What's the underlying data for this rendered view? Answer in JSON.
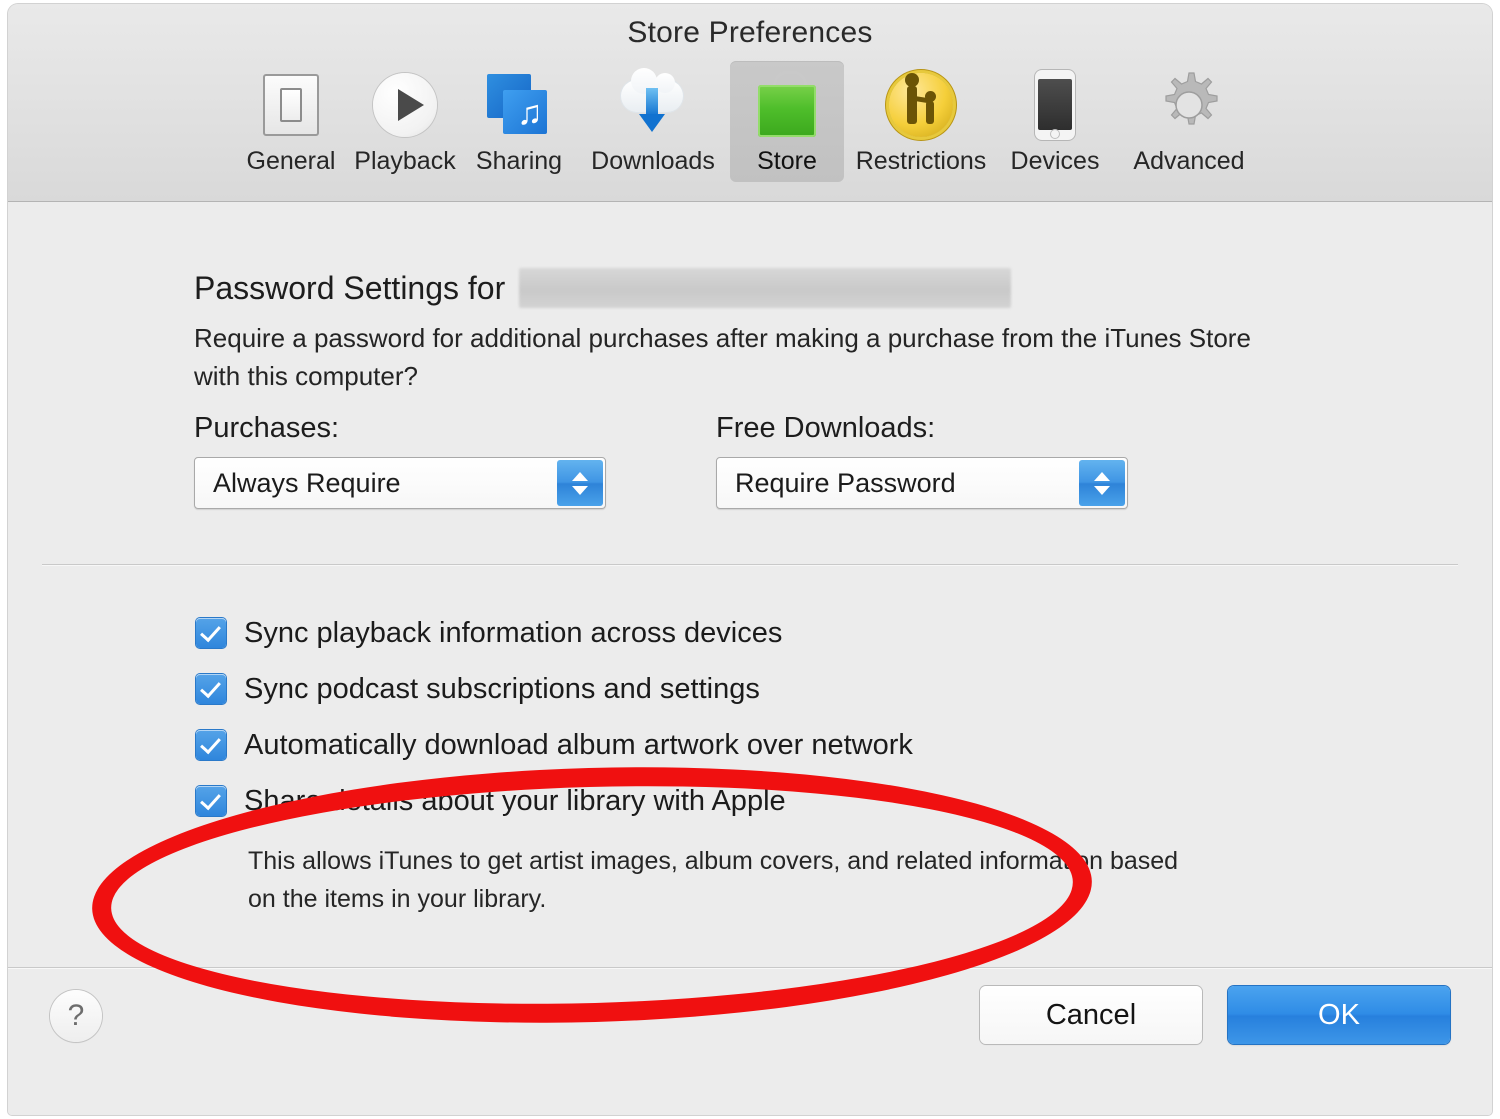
{
  "window": {
    "title": "Store Preferences"
  },
  "toolbar": {
    "tabs": [
      {
        "label": "General",
        "icon": "general-icon",
        "selected": false
      },
      {
        "label": "Playback",
        "icon": "play-icon",
        "selected": false
      },
      {
        "label": "Sharing",
        "icon": "sharing-icon",
        "selected": false
      },
      {
        "label": "Downloads",
        "icon": "cloud-download-icon",
        "selected": false
      },
      {
        "label": "Store",
        "icon": "shopping-bag-icon",
        "selected": true
      },
      {
        "label": "Restrictions",
        "icon": "parental-controls-icon",
        "selected": false
      },
      {
        "label": "Devices",
        "icon": "iphone-icon",
        "selected": false
      },
      {
        "label": "Advanced",
        "icon": "gear-icon",
        "selected": false
      }
    ]
  },
  "password_settings": {
    "heading_prefix": "Password Settings for",
    "account_redacted": "",
    "description": "Require a password for additional purchases after making a purchase from the iTunes Store with this computer?",
    "purchases": {
      "label": "Purchases:",
      "value": "Always Require"
    },
    "free_downloads": {
      "label": "Free Downloads:",
      "value": "Require Password"
    }
  },
  "checkboxes": [
    {
      "label": "Sync playback information across devices",
      "checked": true
    },
    {
      "label": "Sync podcast subscriptions and settings",
      "checked": true
    },
    {
      "label": "Automatically download album artwork over network",
      "checked": true
    },
    {
      "label": "Share details about your library with Apple",
      "checked": true
    }
  ],
  "share_details_note": "This allows iTunes to get artist images, album covers, and related information based on the items in your library.",
  "footer": {
    "help_label": "?",
    "cancel_label": "Cancel",
    "ok_label": "OK"
  },
  "annotation": {
    "shape": "oval",
    "color": "#f01010"
  },
  "colors": {
    "accent_blue": "#2f86dc",
    "ok_button_blue": "#2f8ce6",
    "annotation_red": "#f01010",
    "window_bg": "#ececec",
    "selected_tab_bg": "#c5c5c5"
  }
}
